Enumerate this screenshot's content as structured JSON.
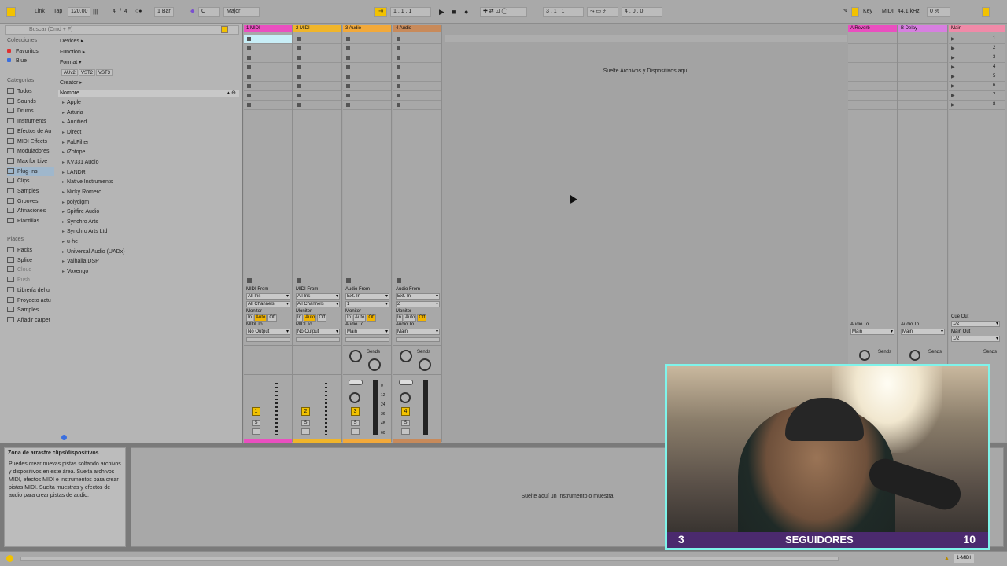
{
  "topbar": {
    "link": "Link",
    "tap": "Tap",
    "tempo": "120.00",
    "time_sig_num": "4",
    "time_sig_den": "4",
    "quantize": "1 Bar",
    "key": "C",
    "scale": "Major",
    "position": "1 . 1 . 1",
    "loop_start": "3 . 1 . 1",
    "loop_len": "4 . 0 . 0",
    "key_label": "Key",
    "midi_label": "MIDI",
    "sample_rate": "44.1 kHz",
    "cpu": "0 %"
  },
  "browser": {
    "search_placeholder": "Buscar (Cmd + F)",
    "collections_title": "Colecciones",
    "collections": [
      {
        "label": "Favoritos",
        "color": "#e03030"
      },
      {
        "label": "Blue",
        "color": "#3a6fe0"
      }
    ],
    "categories_title": "Categorías",
    "categories": [
      "Todos",
      "Sounds",
      "Drums",
      "Instruments",
      "Efectos de Au",
      "MIDI Effects",
      "Moduladores",
      "Max for Live",
      "Plug-Ins",
      "Clips",
      "Samples",
      "Grooves",
      "Afinaciones",
      "Plantillas"
    ],
    "places_title": "Places",
    "places": [
      "Packs",
      "Splice",
      "Cloud",
      "Push",
      "Librería del u",
      "Proyecto actu",
      "Samples",
      "Añadir carpet"
    ],
    "filters": {
      "devices": "Devices ▸",
      "function": "Function ▸",
      "format": "Format ▾",
      "creator": "Creator ▸",
      "formats": [
        "AUv2",
        "VST2",
        "VST3"
      ]
    },
    "column_name": "Nombre",
    "plugins": [
      "Apple",
      "Arturia",
      "Audified",
      "Direct",
      "FabFilter",
      "iZotope",
      "KV331 Audio",
      "LANDR",
      "Native Instruments",
      "Nicky Romero",
      "polydigm",
      "Spitfire Audio",
      "Synchro Arts",
      "Synchro Arts Ltd",
      "u-he",
      "Universal Audio (UADx)",
      "Valhalla DSP",
      "Voxengo"
    ]
  },
  "tracks": [
    {
      "name": "1 MIDI",
      "color": "#ea4fc0",
      "from_label": "MIDI From",
      "from": "All Ins",
      "channel": "All Channels",
      "to_label": "MIDI To",
      "to": "No Output",
      "number": "1"
    },
    {
      "name": "2 MIDI",
      "color": "#f0b52a",
      "from_label": "MIDI From",
      "from": "All Ins",
      "channel": "All Channels",
      "to_label": "MIDI To",
      "to": "No Output",
      "number": "2"
    },
    {
      "name": "3 Audio",
      "color": "#f2a93a",
      "from_label": "Audio From",
      "from": "Ext. In",
      "channel": "1",
      "to_label": "Audio To",
      "to": "Main",
      "number": "3"
    },
    {
      "name": "4 Audio",
      "color": "#c88a5a",
      "from_label": "Audio From",
      "from": "Ext. In",
      "channel": "2",
      "to_label": "Audio To",
      "to": "Main",
      "number": "4"
    }
  ],
  "monitor_label": "Monitor",
  "monitor_opts": [
    "In",
    "Auto",
    "Off"
  ],
  "sends_label": "Sends",
  "solo_label": "S",
  "returns": [
    {
      "name": "A Reverb",
      "color": "#ea4fc0",
      "to_label": "Audio To",
      "to": "Main"
    },
    {
      "name": "B Delay",
      "color": "#d77fe0",
      "to_label": "Audio To",
      "to": "Main"
    },
    {
      "name": "Main",
      "color": "#f08aa8",
      "cue_label": "Cue Out",
      "cue": "1/2",
      "main_label": "Main Out",
      "main": "1/2"
    }
  ],
  "scenes": [
    "1",
    "2",
    "3",
    "4",
    "5",
    "6",
    "7",
    "8"
  ],
  "meter_scale": [
    "0",
    "12",
    "24",
    "36",
    "48",
    "60"
  ],
  "session_drop_hint": "Suelte Archivos y Dispositivos aquí",
  "info": {
    "title": "Zona de arrastre clips/dispositivos",
    "text": "Puedes crear nuevas pistas soltando archivos y dispositivos en este área. Suelta archivos MIDI, efectos MIDI e instrumentos para crear pistas MIDI. Suelta muestras y efectos de audio para crear pistas de audio."
  },
  "detail_drop_hint": "Suelte aquí un Instrumento o muestra",
  "statusbar": {
    "selected_track": "1-MIDI"
  },
  "webcam": {
    "followers_current": "3",
    "followers_label": "SEGUIDORES",
    "followers_goal": "10"
  }
}
